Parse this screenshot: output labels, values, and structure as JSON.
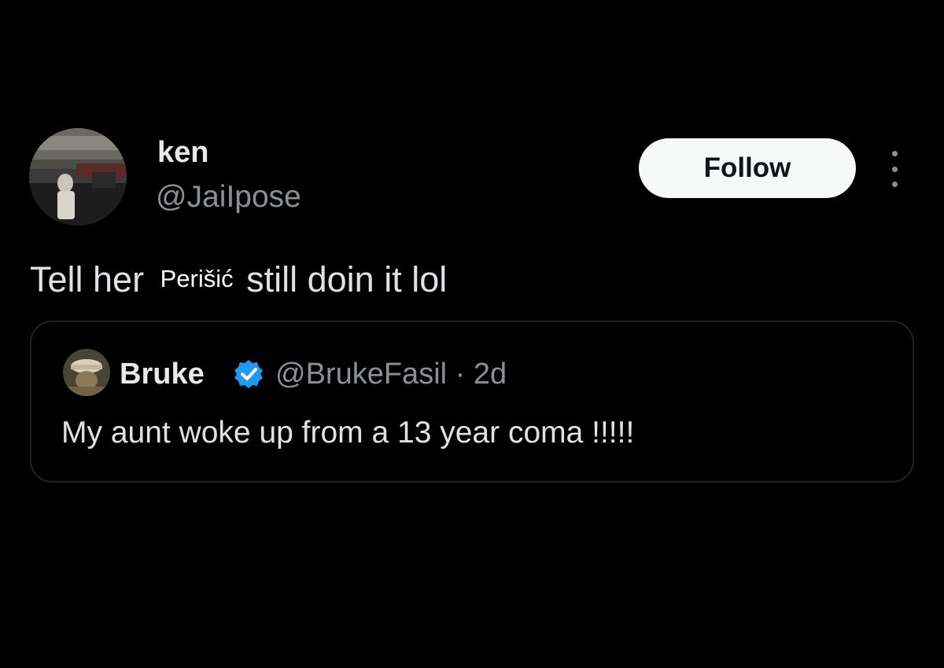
{
  "author": {
    "display_name": "ken",
    "handle": "@JaiIpose",
    "avatar_icon": "profile-photo"
  },
  "actions": {
    "follow_label": "Follow",
    "more_icon": "more-vertical-icon"
  },
  "tweet": {
    "text_before": "Tell her",
    "masked_word": "Perišić",
    "text_after": "still doin it lol"
  },
  "quoted_tweet": {
    "display_name": "Bruke",
    "verified_icon": "verified-badge-icon",
    "handle": "@BrukeFasil",
    "separator": "·",
    "time_ago": "2d",
    "text": "My aunt woke up from a 13 year coma !!!!!"
  },
  "colors": {
    "background": "#000000",
    "primary_text": "#e7e9ea",
    "secondary_text": "#8b9096",
    "follow_bg": "#f7f9f9",
    "verified_blue": "#1d9bf0",
    "card_border": "#1e2226"
  }
}
